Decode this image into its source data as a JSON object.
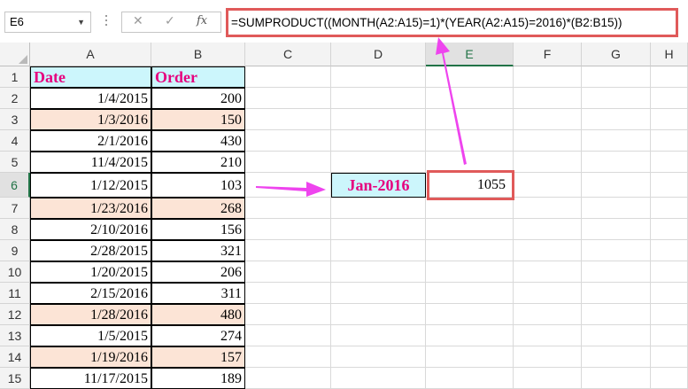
{
  "namebox": {
    "value": "E6"
  },
  "formula_bar": {
    "cancel_icon": "close-icon",
    "enter_icon": "check-icon",
    "fx_label": "fx",
    "formula": "=SUMPRODUCT((MONTH(A2:A15)=1)*(YEAR(A2:A15)=2016)*(B2:B15))"
  },
  "columns": [
    "A",
    "B",
    "C",
    "D",
    "E",
    "F",
    "G",
    "H"
  ],
  "rows": [
    "1",
    "2",
    "3",
    "4",
    "5",
    "6",
    "7",
    "8",
    "9",
    "10",
    "11",
    "12",
    "13",
    "14",
    "15"
  ],
  "table": {
    "headers": {
      "date": "Date",
      "order": "Order"
    },
    "rows": [
      {
        "date": "1/4/2015",
        "order": "200",
        "highlight": false
      },
      {
        "date": "1/3/2016",
        "order": "150",
        "highlight": true
      },
      {
        "date": "2/1/2016",
        "order": "430",
        "highlight": false
      },
      {
        "date": "11/4/2015",
        "order": "210",
        "highlight": false
      },
      {
        "date": "1/12/2015",
        "order": "103",
        "highlight": false
      },
      {
        "date": "1/23/2016",
        "order": "268",
        "highlight": true
      },
      {
        "date": "2/10/2016",
        "order": "156",
        "highlight": false
      },
      {
        "date": "2/28/2015",
        "order": "321",
        "highlight": false
      },
      {
        "date": "1/20/2015",
        "order": "206",
        "highlight": false
      },
      {
        "date": "2/15/2016",
        "order": "311",
        "highlight": false
      },
      {
        "date": "1/28/2016",
        "order": "480",
        "highlight": true
      },
      {
        "date": "1/5/2015",
        "order": "274",
        "highlight": false
      },
      {
        "date": "1/19/2016",
        "order": "157",
        "highlight": true
      },
      {
        "date": "11/17/2015",
        "order": "189",
        "highlight": false
      }
    ]
  },
  "criteria": {
    "label": "Jan-2016",
    "result": "1055"
  },
  "colors": {
    "header_text": "#e6007e",
    "header_fill": "#ccf6fc",
    "highlight_fill": "#fce4d6",
    "callout_border": "#e05a5a",
    "arrow": "#ee44ee",
    "active_header": "#217346"
  }
}
